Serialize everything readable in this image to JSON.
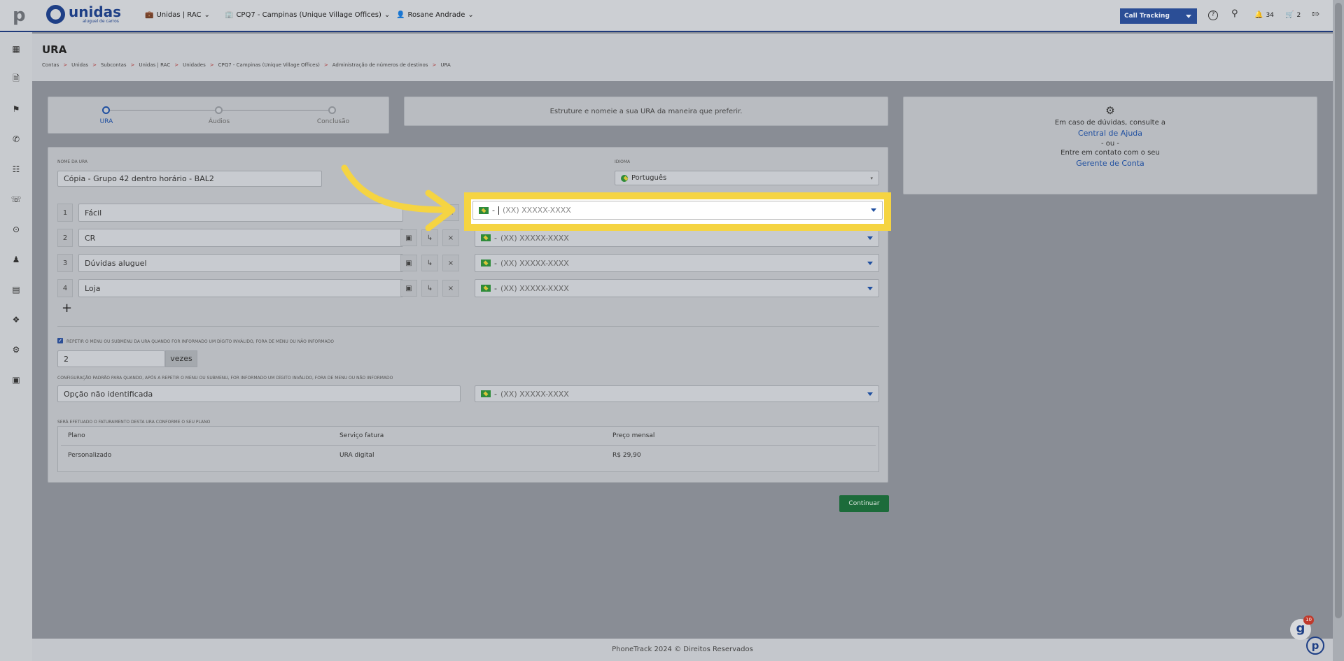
{
  "brand": {
    "logo_text": "unidas",
    "logo_sub": "aluguel de carros"
  },
  "topbar": {
    "account": "Unidas | RAC",
    "subaccount": "CPQ7 - Campinas (Unique Village Offices)",
    "user": "Rosane Andrade",
    "product_button": "Call Tracking",
    "notifications_count": "34",
    "cart_count": "2"
  },
  "page": {
    "title": "URA",
    "breadcrumb": [
      "Contas",
      ">",
      "Unidas",
      ">",
      "Subcontas",
      ">",
      "Unidas | RAC",
      ">",
      "Unidades",
      ">",
      "CPQ7 - Campinas (Unique Village Offices)",
      ">",
      "Administração de números de destinos",
      ">",
      "URA"
    ]
  },
  "steps": [
    "URA",
    "Áudios",
    "Conclusão"
  ],
  "hint": "Estruture e nomeie a sua URA da maneira que preferir.",
  "help": {
    "line1": "Em caso de dúvidas, consulte a",
    "link1": "Central de Ajuda",
    "or": "- ou -",
    "line2": "Entre em contato com o seu",
    "link2": "Gerente de Conta"
  },
  "form": {
    "name_label": "NOME DA URA",
    "name_value": "Cópia - Grupo 42 dentro horário - BAL2",
    "language_label": "IDIOMA",
    "language_value": "Português",
    "options": [
      {
        "num": "1",
        "label": "Fácil",
        "phone_placeholder": "(XX) XXXXX-XXXX"
      },
      {
        "num": "2",
        "label": "CR",
        "phone_placeholder": "(XX) XXXXX-XXXX"
      },
      {
        "num": "3",
        "label": "Dúvidas aluguel",
        "phone_placeholder": "(XX) XXXXX-XXXX"
      },
      {
        "num": "4",
        "label": "Loja",
        "phone_placeholder": "(XX) XXXXX-XXXX"
      }
    ],
    "add_label": "+",
    "repeat_label": "REPETIR O MENU OU SUBMENU DA URA QUANDO FOR INFORMADO UM DÍGITO INVÁLIDO, FORA DE MENU OU NÃO INFORMADO",
    "repeat_value": "2",
    "repeat_unit": "vezes",
    "default_label": "CONFIGURAÇÃO PADRÃO PARA QUANDO, APÓS A REPETIR O MENU OU SUBMENU, FOR INFORMADO UM DÍGITO INVÁLIDO, FORA DE MENU OU NÃO INFORMADO",
    "default_value": "Opção não identificada",
    "default_phone_placeholder": "(XX) XXXXX-XXXX",
    "billing_label": "SERÁ EFETUADO O FATURAMENTO DESTA URA CONFORME O SEU PLANO",
    "billing_headers": [
      "Plano",
      "Serviço fatura",
      "Preço mensal"
    ],
    "billing_row": [
      "Personalizado",
      "URA digital",
      "R$ 29,90"
    ],
    "flag_sep": "-"
  },
  "continue_label": "Continuar",
  "footer": "PhoneTrack 2024 © Direitos Reservados",
  "widget_badge": "10",
  "colors": {
    "highlight": "#f5d442",
    "arrow": "#f5d442",
    "primary": "#1f4fa0",
    "continue": "#1c6b3a"
  }
}
